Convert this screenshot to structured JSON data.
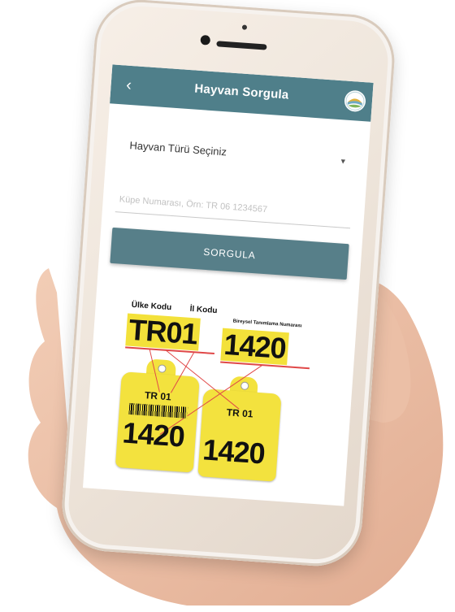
{
  "header": {
    "title": "Hayvan Sorgula",
    "back_glyph": "‹"
  },
  "form": {
    "animal_type_label": "Hayvan Türü Seçiniz",
    "dropdown_glyph": "▼",
    "ear_tag_placeholder": "Küpe Numarası, Örn: TR 06 1234567",
    "query_button": "SORGULA"
  },
  "illustration": {
    "country_code_label": "Ülke Kodu",
    "province_code_label": "İl Kodu",
    "individual_number_label": "Bireysel Tanımlama Numarası",
    "country_province": "TR01",
    "number": "1420",
    "tag_prefix": "TR 01",
    "tag_number": "1420"
  },
  "colors": {
    "header": "#4f7f8a",
    "button": "#577f89",
    "tag_yellow": "#f3e23e"
  }
}
